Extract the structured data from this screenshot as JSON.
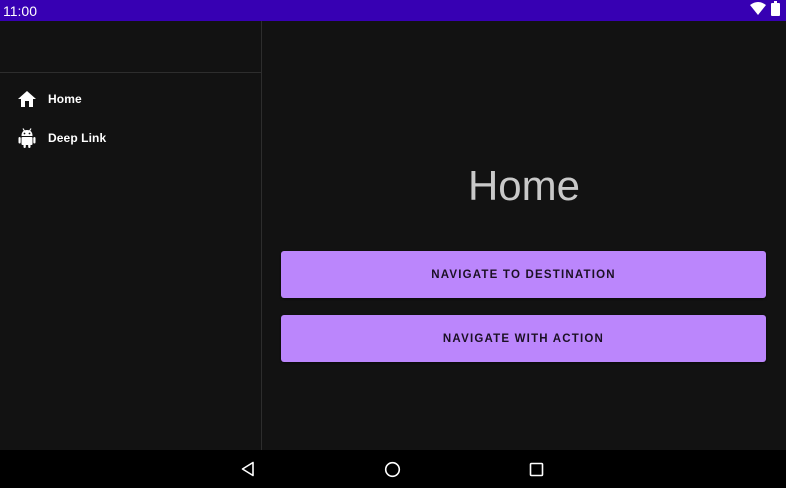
{
  "status_bar": {
    "time": "11:00",
    "icons": [
      "wifi-icon",
      "battery-icon"
    ]
  },
  "drawer": {
    "items": [
      {
        "label": "Home",
        "icon": "home-icon"
      },
      {
        "label": "Deep Link",
        "icon": "android-icon"
      }
    ]
  },
  "main": {
    "title": "Home",
    "buttons": [
      {
        "label": "NAVIGATE TO DESTINATION"
      },
      {
        "label": "NAVIGATE WITH ACTION"
      }
    ]
  },
  "nav_bar": {
    "icons": [
      "back-icon",
      "home-circle-icon",
      "recents-icon"
    ]
  },
  "colors": {
    "status_bar": "#3700b3",
    "background": "#121212",
    "accent": "#bb86fc",
    "title_text": "#c9c9c9"
  }
}
